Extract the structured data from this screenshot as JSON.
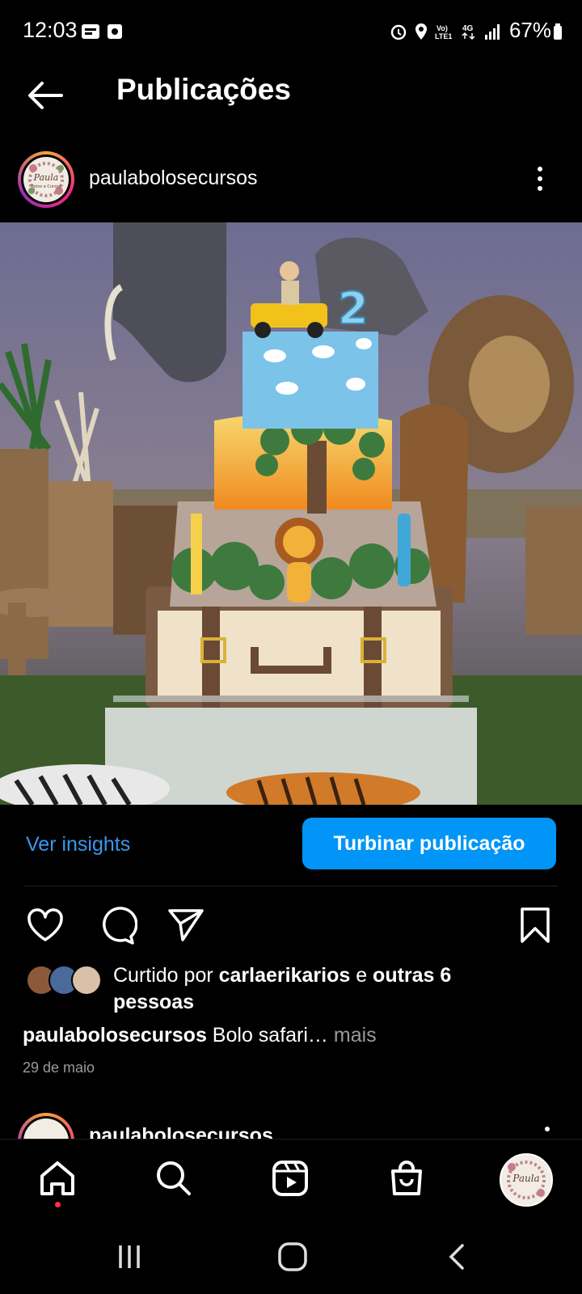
{
  "status_bar": {
    "time": "12:03",
    "battery_pct": "67%",
    "icons": [
      "alarm-icon",
      "location-icon",
      "volte-icon",
      "4g-icon",
      "signal-icon",
      "battery-icon"
    ]
  },
  "header": {
    "title": "Publicações",
    "back_icon": "arrow-left-icon"
  },
  "post": {
    "username": "paulabolosecursos",
    "avatar_text": "Paula",
    "avatar_subtext": "Bolos e Cursos",
    "insights_label": "Ver insights",
    "boost_label": "Turbinar publicação",
    "likes_prefix": "Curtido por ",
    "likes_user": "carlaerikarios",
    "likes_mid": " e ",
    "likes_rest": "outras 6 pessoas",
    "caption_user": "paulabolosecursos",
    "caption_text": " Bolo safari…",
    "caption_more": " mais",
    "date": "29 de maio",
    "cake_number": "2"
  },
  "next_post": {
    "username": "paulabolosecursos"
  },
  "nav": {
    "items": [
      "home-icon",
      "search-icon",
      "reels-icon",
      "shop-icon",
      "profile-avatar"
    ]
  },
  "colors": {
    "accent": "#0095f6",
    "link": "#3897f0",
    "notification": "#ff3040"
  }
}
